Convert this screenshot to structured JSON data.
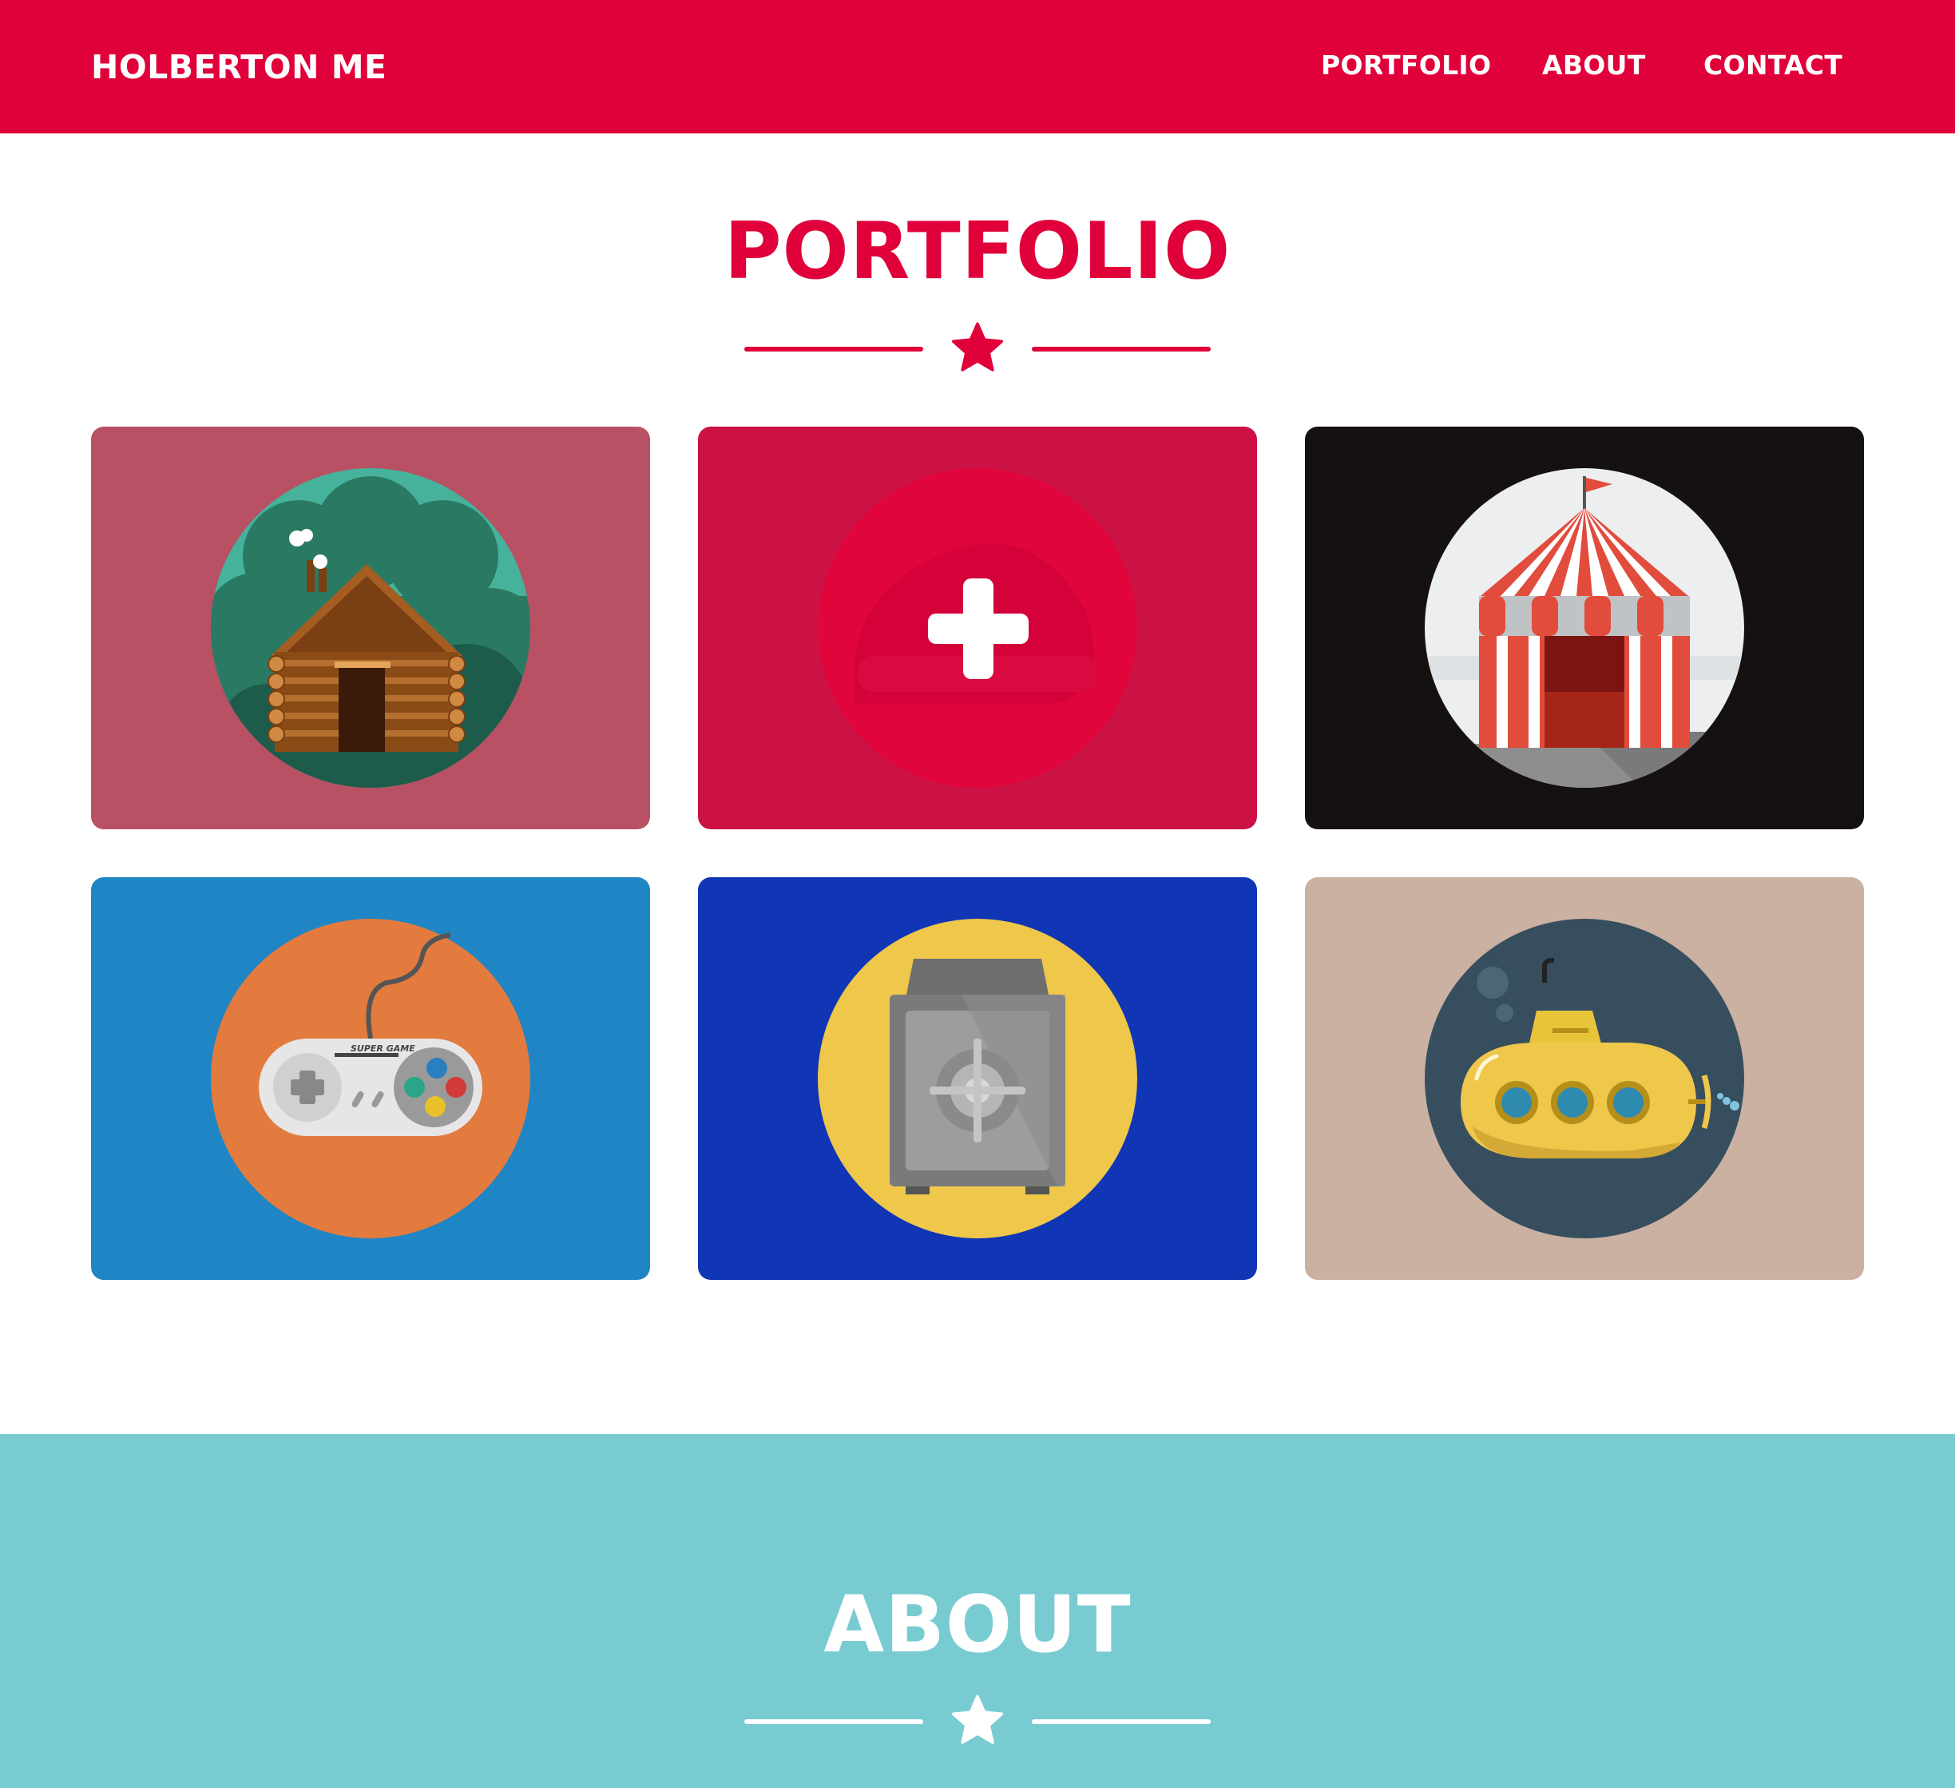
{
  "header": {
    "brand": "HOLBERTON ME",
    "nav": [
      "PORTFOLIO",
      "ABOUT",
      "CONTACT"
    ]
  },
  "portfolio": {
    "title": "PORTFOLIO",
    "items": [
      {
        "icon": "cabin-icon",
        "background": "#b75163"
      },
      {
        "icon": "plus-icon",
        "background": "#cc1244"
      },
      {
        "icon": "circus-tent-icon",
        "background": "#141110"
      },
      {
        "icon": "game-controller-icon",
        "background": "#2085c4",
        "printed_label": "SUPER GAME"
      },
      {
        "icon": "safe-icon",
        "background": "#1035b5"
      },
      {
        "icon": "submarine-icon",
        "background": "#cbb1a2"
      }
    ]
  },
  "about": {
    "title": "ABOUT"
  },
  "colors": {
    "primary": "#e0003a",
    "about_background": "#78ccd1",
    "white": "#ffffff"
  }
}
